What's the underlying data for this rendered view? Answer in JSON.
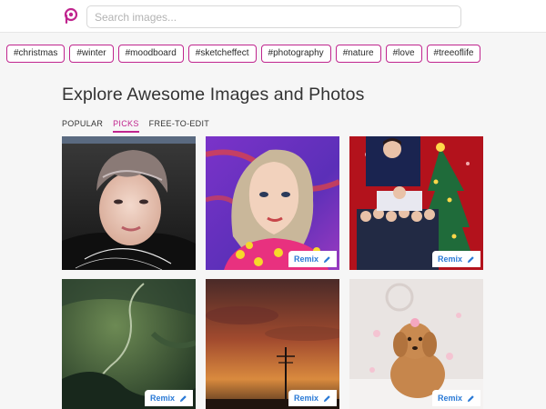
{
  "header": {
    "logo_icon": "picsart-logo-icon",
    "search_placeholder": "Search images...",
    "search_value": ""
  },
  "tags": [
    "#christmas",
    "#winter",
    "#moodboard",
    "#sketcheffect",
    "#photography",
    "#nature",
    "#love",
    "#treeoflife"
  ],
  "page_title": "Explore Awesome Images and Photos",
  "tabs": [
    {
      "label": "POPULAR",
      "active": false
    },
    {
      "label": "PICKS",
      "active": true
    },
    {
      "label": "FREE-TO-EDIT",
      "active": false
    }
  ],
  "grid": {
    "remix_label": "Remix",
    "remix_icon": "pencil-icon",
    "items": [
      {
        "subject": "boy-portrait",
        "has_remix": false
      },
      {
        "subject": "woman-illustration",
        "has_remix": true
      },
      {
        "subject": "group-christmas-tree",
        "has_remix": true
      },
      {
        "subject": "aerial-landscape",
        "has_remix": true
      },
      {
        "subject": "sunset-sky",
        "has_remix": true
      },
      {
        "subject": "poodle-dog",
        "has_remix": true
      }
    ]
  },
  "colors": {
    "accent": "#c0258e",
    "remix_text": "#2a7ad6",
    "background": "#f6f6f6"
  }
}
